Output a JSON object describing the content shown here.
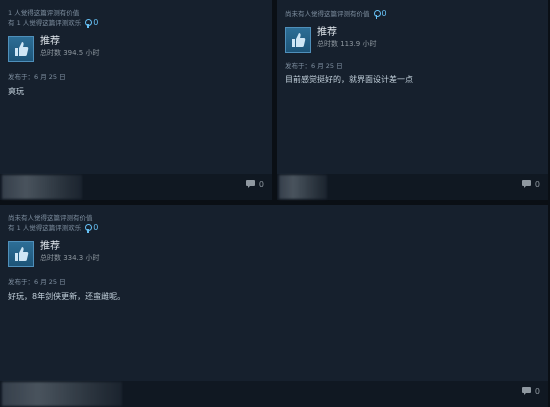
{
  "reviews": [
    {
      "helpful": "1 人觉得这篇评测有价值",
      "funny": "有 1 人觉得这篇评测欢乐",
      "award_count": "0",
      "recommendation": "推荐",
      "hours": "总时数 394.5 小时",
      "posted": "发布于：6 月 25 日",
      "text": "爽玩",
      "comment_count": "0"
    },
    {
      "helpful": "尚未有人觉得这篇评测有价值",
      "award_count": "0",
      "recommendation": "推荐",
      "hours": "总时数 113.9 小时",
      "posted": "发布于：6 月 25 日",
      "text": "目前感觉挺好的，就界面设计差一点",
      "comment_count": "0"
    },
    {
      "helpful": "尚未有人觉得这篇评测有价值",
      "funny": "有 1 人觉得这篇评测欢乐",
      "award_count": "0",
      "recommendation": "推荐",
      "hours": "总时数 334.3 小时",
      "posted": "发布于：6 月 25 日",
      "text": "好玩，8年剑侠更新，还蛮雌呢。",
      "comment_count": "0"
    }
  ],
  "icons": {
    "thumb": "thumbs-up-icon",
    "award": "award-icon",
    "comment": "comment-icon"
  },
  "colors": {
    "card_bg": "#16202d",
    "footer_bg": "#101822",
    "accent": "#66c0f4",
    "thumb_bg": "#1d5478"
  }
}
